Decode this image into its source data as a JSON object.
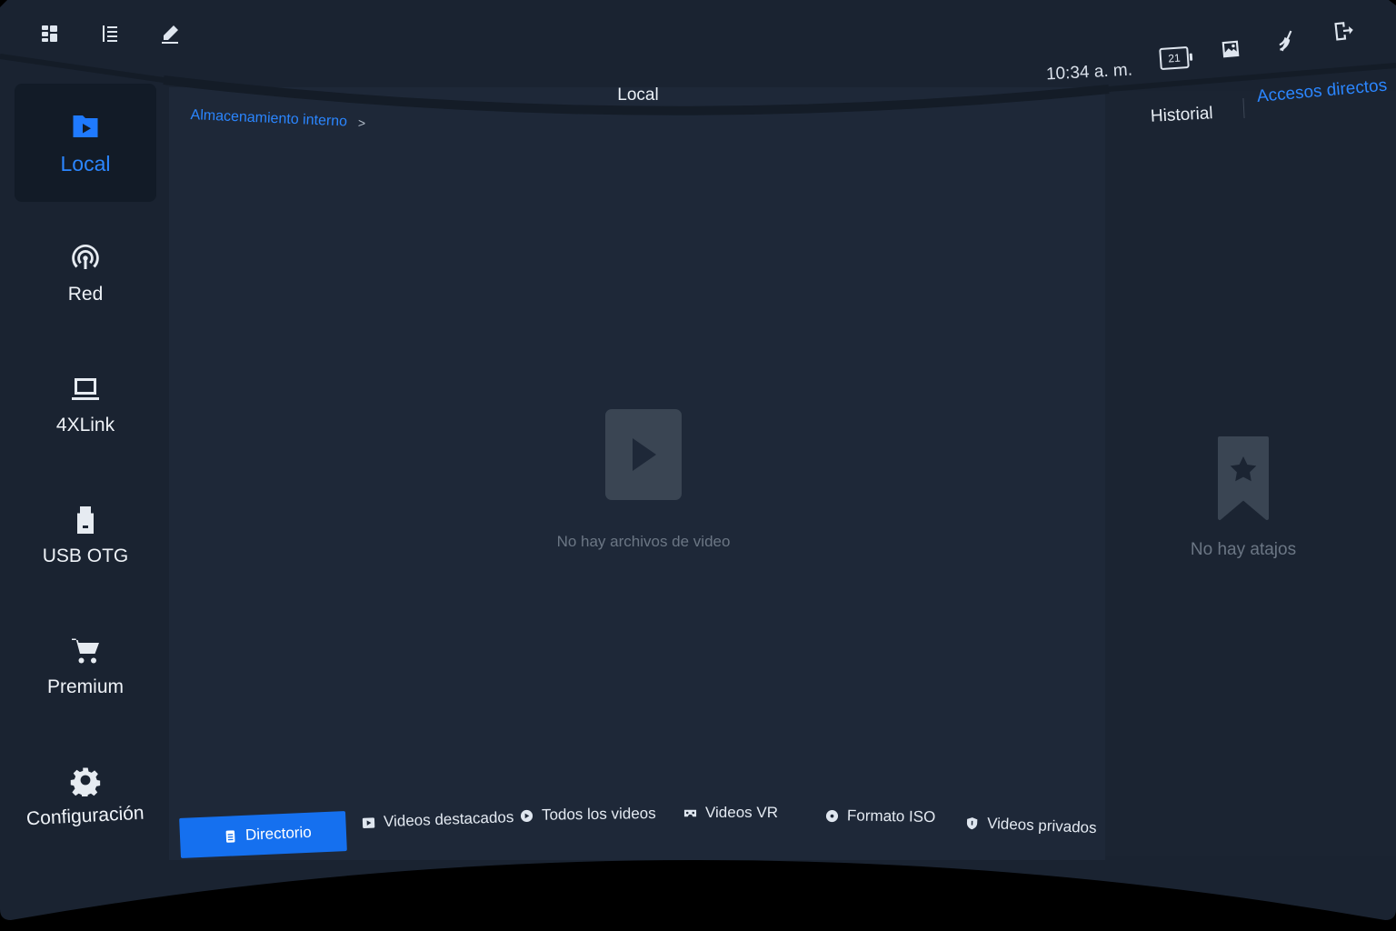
{
  "header": {
    "title": "Local",
    "time": "10:34 a. m.",
    "battery_level": "21"
  },
  "toolbar_left": {
    "icons": [
      "grid-view-icon",
      "list-view-icon",
      "edit-icon"
    ]
  },
  "toolbar_right": {
    "icons": [
      "battery-icon",
      "gallery-icon",
      "no-cast-icon",
      "exit-icon"
    ]
  },
  "sidebar": {
    "items": [
      {
        "label": "Local",
        "icon": "local-file-icon",
        "active": true
      },
      {
        "label": "Red",
        "icon": "network-icon",
        "active": false
      },
      {
        "label": "4XLink",
        "icon": "laptop-icon",
        "active": false
      },
      {
        "label": "USB OTG",
        "icon": "usb-drive-icon",
        "active": false
      },
      {
        "label": "Premium",
        "icon": "cart-icon",
        "active": false
      },
      {
        "label": "Configuración",
        "icon": "gear-icon",
        "active": false
      }
    ]
  },
  "breadcrumb": {
    "path": "Almacenamiento interno",
    "separator": ">"
  },
  "main": {
    "empty_message": "No hay archivos de video"
  },
  "right_panel": {
    "tab_history": "Historial",
    "tab_shortcuts": "Accesos directos",
    "empty_message": "No hay atajos"
  },
  "bottom_tabs": [
    {
      "label": "Directorio",
      "icon": "directory-icon",
      "active": true
    },
    {
      "label": "Videos destacados",
      "icon": "featured-video-icon",
      "active": false
    },
    {
      "label": "Todos los videos",
      "icon": "play-circle-icon",
      "active": false
    },
    {
      "label": "Videos VR",
      "icon": "vr-headset-icon",
      "active": false
    },
    {
      "label": "Formato ISO",
      "icon": "disc-icon",
      "active": false
    },
    {
      "label": "Videos privados",
      "icon": "shield-icon",
      "active": false
    }
  ],
  "colors": {
    "accent": "#1f7aff",
    "panel": "#1a2331",
    "center": "#1e2838",
    "muted_text": "#6b7684"
  }
}
